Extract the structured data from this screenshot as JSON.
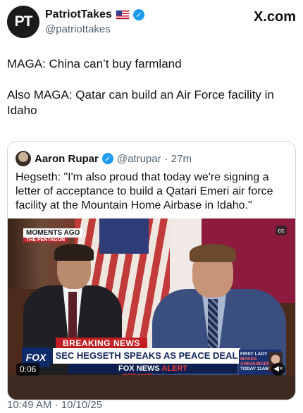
{
  "header": {
    "avatar_initials": "PT",
    "display_name": "PatriotTakes",
    "handle": "@patriottakes",
    "brand": "X.com"
  },
  "tweet": {
    "line1": "MAGA: China can’t buy farmland",
    "line2": "Also MAGA: Qatar can build an Air Force facility in Idaho"
  },
  "quote": {
    "name": "Aaron Rupar",
    "handle": "@atrupar",
    "age": "· 27m",
    "text": "Hegseth: \"I'm also proud that today we're signing a letter of acceptance to build a Qatari Emeri air force facility at the Mountain Home Airbase in Idaho.\"",
    "video": {
      "moments": "MOMENTS AGO",
      "location": "THE PENTAGON",
      "breaking": "BREAKING NEWS",
      "chyron": "SEC HEGSETH SPEAKS AS PEACE DEAL TAKES HOLD",
      "fox_logo": "FOX",
      "fox_news": "FOX NEWS",
      "alert": "ALERT",
      "first_lady_1": "FIRST LADY",
      "first_lady_2": "MAKES",
      "first_lady_3": "ANNOUNCEMENT",
      "first_lady_4": "TODAY 11AM",
      "timestamp": "0:06"
    }
  },
  "footer": {
    "posted": "10:49 AM · 10/10/25"
  },
  "colors": {
    "verified": "#1d9bf0",
    "muted_text": "#536471"
  }
}
